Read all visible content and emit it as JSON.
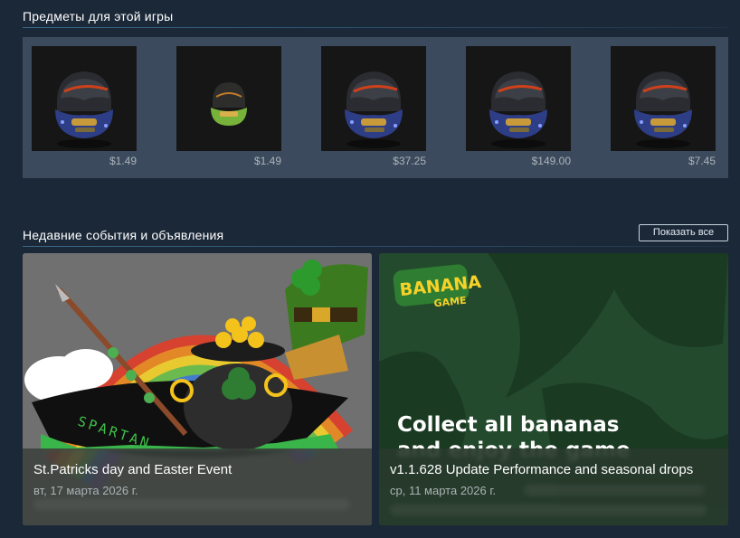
{
  "items_section": {
    "title": "Предметы для этой игры",
    "items": [
      {
        "price": "$1.49",
        "icon": "helmet-icon"
      },
      {
        "price": "$1.49",
        "icon": "helmet-small-green-icon"
      },
      {
        "price": "$37.25",
        "icon": "helmet-icon"
      },
      {
        "price": "$149.00",
        "icon": "helmet-icon"
      },
      {
        "price": "$7.45",
        "icon": "helmet-icon"
      }
    ]
  },
  "events_section": {
    "title": "Недавние события и объявления",
    "show_all_label": "Показать все",
    "events": [
      {
        "title": "St.Patricks day and Easter Event",
        "date": "вт, 17 марта 2026 г.",
        "banner_text": "SPARTAN"
      },
      {
        "title": "v1.1.628 Update Performance and seasonal drops",
        "date": "ср, 11 марта 2026 г.",
        "logo_text_top": "BANANA",
        "logo_text_bottom": "GAME",
        "banner_line1": "Collect all bananas",
        "banner_line2": "and enjoy the game"
      }
    ]
  },
  "colors": {
    "page_bg": "#1b2838",
    "panel_bg": "#3b4b5d",
    "price_text": "#acb2b8",
    "card_green": "#24452c"
  }
}
